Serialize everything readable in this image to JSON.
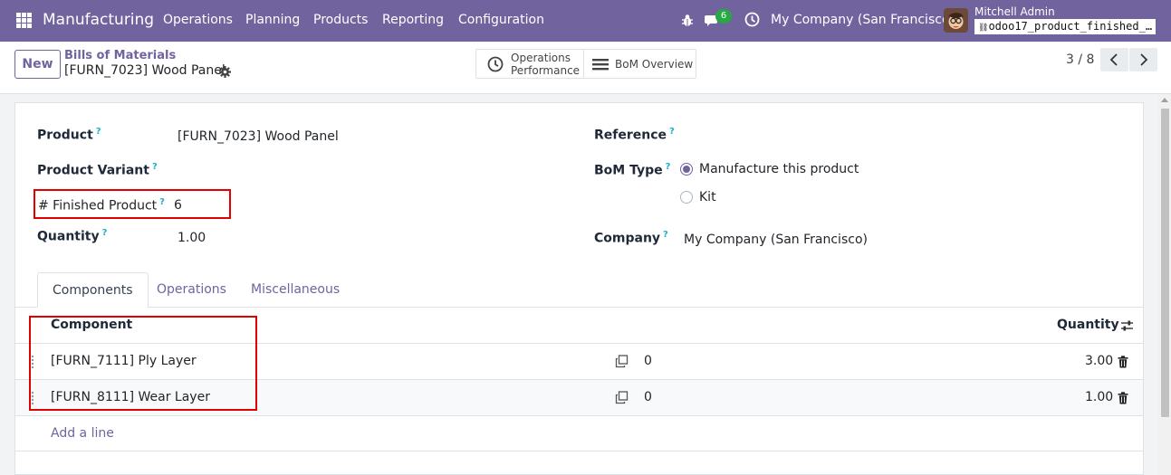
{
  "navbar": {
    "app_name": "Manufacturing",
    "menu": [
      "Operations",
      "Planning",
      "Products",
      "Reporting",
      "Configuration"
    ],
    "message_count": "6",
    "company": "My Company (San Francisco)",
    "user_name": "Mitchell Admin",
    "database": "odoo17_product_finished_…"
  },
  "control": {
    "new_label": "New",
    "breadcrumb_parent": "Bills of Materials",
    "breadcrumb_current": "[FURN_7023] Wood Panel",
    "smart_ops_line1": "Operations",
    "smart_ops_line2": "Performance",
    "smart_bom": "BoM Overview",
    "pager": "3 / 8"
  },
  "form": {
    "product_label": "Product",
    "product_value": "[FURN_7023] Wood Panel",
    "variant_label": "Product Variant",
    "finished_label": "# Finished Product",
    "finished_value": "6",
    "quantity_label": "Quantity",
    "quantity_value": "1.00",
    "reference_label": "Reference",
    "bom_type_label": "BoM Type",
    "bom_type_options": [
      "Manufacture this product",
      "Kit"
    ],
    "bom_type_selected": "Manufacture this product",
    "company_label": "Company",
    "company_value": "My Company (San Francisco)",
    "help_mark": "?"
  },
  "tabs": [
    "Components",
    "Operations",
    "Miscellaneous"
  ],
  "active_tab": "Components",
  "components": {
    "col_component": "Component",
    "col_quantity": "Quantity",
    "rows": [
      {
        "component": "[FURN_7111] Ply Layer",
        "mid_value": "0",
        "quantity": "3.00"
      },
      {
        "component": "[FURN_8111] Wear Layer",
        "mid_value": "0",
        "quantity": "1.00"
      }
    ],
    "add_line": "Add a line"
  },
  "colors": {
    "brand": "#71639e",
    "highlight": "#e00000",
    "help": "#1cb0c8"
  }
}
